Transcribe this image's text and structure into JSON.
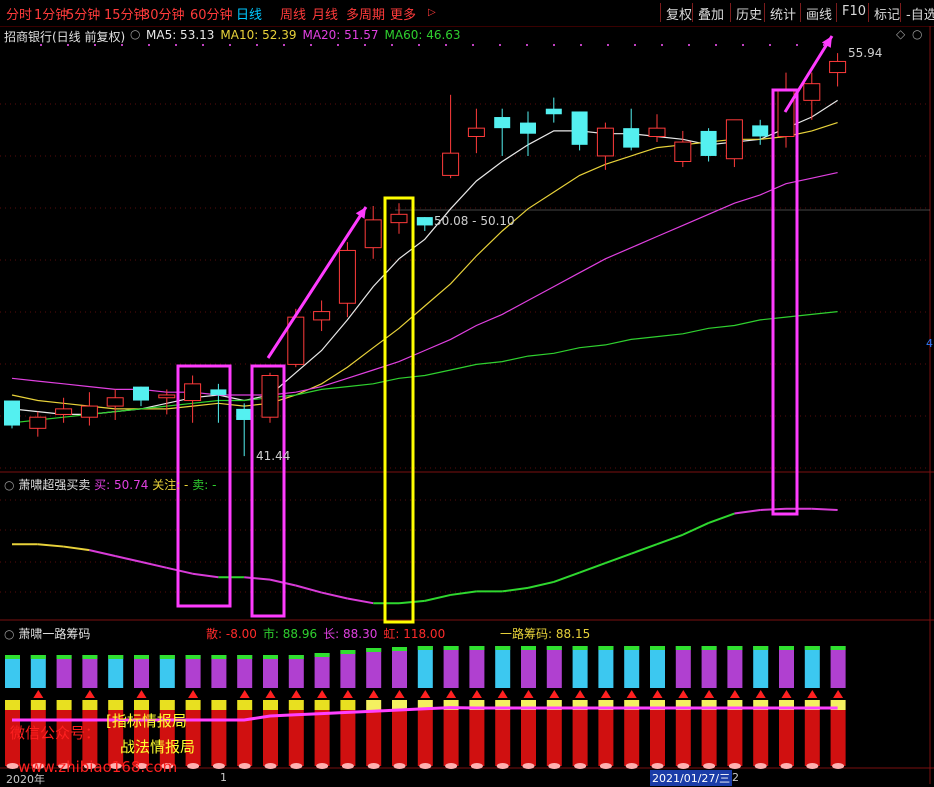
{
  "toolbar": {
    "periods": [
      "分时",
      "1分钟",
      "5分钟",
      "15分钟",
      "30分钟",
      "60分钟",
      "日线",
      "周线",
      "月线",
      "多周期",
      "更多"
    ],
    "active_period": "日线",
    "more_arrow": "▷",
    "right_buttons": [
      "复权",
      "叠加",
      "历史",
      "统计",
      "画线",
      "F10",
      "标记",
      "-自选"
    ]
  },
  "main_pane": {
    "title": "招商银行(日线 前复权)",
    "ma_items": [
      {
        "label": "MA5: 53.13",
        "color": "#e8e8e8"
      },
      {
        "label": "MA10: 52.39",
        "color": "#e8d23a"
      },
      {
        "label": "MA20: 51.57",
        "color": "#e040e0"
      },
      {
        "label": "MA60: 46.63",
        "color": "#2fd02f"
      }
    ],
    "high_label": "55.94",
    "low_label": "41.44",
    "range_label": "50.08 - 50.10",
    "axis_marker": "4",
    "diamond_icon": "◇",
    "close_icon": "○"
  },
  "indicator1": {
    "title": "萧啸超强买卖",
    "buy_label": "买: 50.74",
    "follow_label": "关注: -",
    "sell_label": "卖: -"
  },
  "indicator2": {
    "title": "萧啸一路筹码",
    "items": [
      {
        "label": "散: -8.00",
        "color": "#ff2b2b"
      },
      {
        "label": "市: 88.96",
        "color": "#2fd02f"
      },
      {
        "label": "长: 88.30",
        "color": "#e040e0"
      },
      {
        "label": "虹: 118.00",
        "color": "#ff2b2b"
      }
    ],
    "chip_label": "一路筹码: 88.15"
  },
  "bottom_axis": {
    "year_label": "2020年",
    "tick_label": "1",
    "date_label": "2021/01/27/三",
    "date_suffix": "2"
  },
  "watermark": {
    "line1": "微信公众号：",
    "line1b": "[指标情报局",
    "line2": "战法情报局",
    "line3": "www.zhibiao168.com"
  },
  "colors": {
    "up": "#ff3b3b",
    "down": "#54f0f0",
    "ma5": "#e8e8e8",
    "ma10": "#e8d23a",
    "ma20": "#e040e0",
    "ma60": "#2fd02f",
    "box_magenta": "#ff3cff",
    "box_yellow": "#ffff00"
  },
  "chart_data": {
    "type": "candlestick",
    "title": "招商银行(日线 前复权)",
    "candles": [
      {
        "o": 43.4,
        "h": 43.4,
        "l": 42.4,
        "c": 42.5
      },
      {
        "o": 42.4,
        "h": 43.0,
        "l": 42.1,
        "c": 42.8
      },
      {
        "o": 42.9,
        "h": 43.5,
        "l": 42.6,
        "c": 43.1
      },
      {
        "o": 42.8,
        "h": 43.7,
        "l": 42.5,
        "c": 43.2
      },
      {
        "o": 43.2,
        "h": 43.8,
        "l": 42.7,
        "c": 43.5
      },
      {
        "o": 43.9,
        "h": 43.9,
        "l": 43.2,
        "c": 43.4
      },
      {
        "o": 43.5,
        "h": 43.8,
        "l": 42.9,
        "c": 43.6
      },
      {
        "o": 43.4,
        "h": 44.3,
        "l": 42.6,
        "c": 44.0
      },
      {
        "o": 43.8,
        "h": 44.0,
        "l": 42.6,
        "c": 43.6
      },
      {
        "o": 43.1,
        "h": 43.3,
        "l": 41.4,
        "c": 42.7
      },
      {
        "o": 42.8,
        "h": 44.4,
        "l": 42.6,
        "c": 44.3
      },
      {
        "o": 44.7,
        "h": 46.7,
        "l": 44.6,
        "c": 46.4
      },
      {
        "o": 46.3,
        "h": 47.0,
        "l": 45.9,
        "c": 46.6
      },
      {
        "o": 46.9,
        "h": 49.1,
        "l": 46.4,
        "c": 48.8
      },
      {
        "o": 48.9,
        "h": 50.4,
        "l": 48.5,
        "c": 49.9
      },
      {
        "o": 49.8,
        "h": 50.5,
        "l": 49.4,
        "c": 50.1
      },
      {
        "o": 50.0,
        "h": 50.0,
        "l": 49.5,
        "c": 49.7
      },
      {
        "o": 51.5,
        "h": 54.4,
        "l": 51.4,
        "c": 52.3
      },
      {
        "o": 52.9,
        "h": 53.9,
        "l": 52.3,
        "c": 53.2
      },
      {
        "o": 53.6,
        "h": 53.9,
        "l": 52.2,
        "c": 53.2
      },
      {
        "o": 53.4,
        "h": 53.8,
        "l": 52.2,
        "c": 53.0
      },
      {
        "o": 53.9,
        "h": 54.3,
        "l": 53.4,
        "c": 53.7
      },
      {
        "o": 53.8,
        "h": 53.8,
        "l": 52.4,
        "c": 52.6
      },
      {
        "o": 52.2,
        "h": 53.4,
        "l": 51.7,
        "c": 53.2
      },
      {
        "o": 53.2,
        "h": 53.9,
        "l": 52.4,
        "c": 52.5
      },
      {
        "o": 52.9,
        "h": 53.7,
        "l": 52.7,
        "c": 53.2
      },
      {
        "o": 52.0,
        "h": 53.1,
        "l": 51.8,
        "c": 52.7
      },
      {
        "o": 53.1,
        "h": 53.2,
        "l": 52.0,
        "c": 52.2
      },
      {
        "o": 52.1,
        "h": 53.5,
        "l": 51.8,
        "c": 53.5
      },
      {
        "o": 53.3,
        "h": 53.5,
        "l": 52.6,
        "c": 52.9
      },
      {
        "o": 52.9,
        "h": 55.2,
        "l": 52.5,
        "c": 54.6
      },
      {
        "o": 54.2,
        "h": 55.2,
        "l": 53.5,
        "c": 54.8
      },
      {
        "o": 55.2,
        "h": 55.9,
        "l": 54.7,
        "c": 55.6
      }
    ],
    "series": [
      {
        "name": "MA5",
        "values": [
          43.1,
          43.0,
          42.9,
          42.9,
          43.0,
          43.1,
          43.3,
          43.5,
          43.6,
          43.4,
          43.6,
          44.4,
          45.2,
          46.3,
          47.5,
          48.5,
          49.2,
          50.3,
          51.3,
          52.0,
          52.6,
          53.1,
          53.1,
          53.0,
          53.0,
          52.9,
          52.8,
          52.6,
          52.7,
          52.8,
          53.2,
          53.6,
          54.2
        ]
      },
      {
        "name": "MA10",
        "values": [
          43.6,
          43.4,
          43.3,
          43.2,
          43.1,
          43.1,
          43.1,
          43.2,
          43.3,
          43.2,
          43.3,
          43.6,
          44.0,
          44.6,
          45.3,
          46.0,
          46.8,
          47.6,
          48.6,
          49.5,
          50.3,
          50.9,
          51.5,
          51.9,
          52.2,
          52.5,
          52.6,
          52.7,
          52.8,
          52.8,
          52.9,
          53.1,
          53.4
        ]
      },
      {
        "name": "MA20",
        "values": [
          44.2,
          44.1,
          44.0,
          43.9,
          43.8,
          43.8,
          43.7,
          43.7,
          43.6,
          43.6,
          43.6,
          43.7,
          43.9,
          44.2,
          44.5,
          44.8,
          45.2,
          45.6,
          46.1,
          46.5,
          47.0,
          47.5,
          48.0,
          48.5,
          48.9,
          49.3,
          49.7,
          50.1,
          50.5,
          50.8,
          51.2,
          51.4,
          51.6
        ]
      },
      {
        "name": "MA60",
        "values": [
          42.6,
          42.7,
          42.8,
          42.9,
          43.0,
          43.1,
          43.2,
          43.3,
          43.4,
          43.4,
          43.5,
          43.6,
          43.8,
          43.9,
          44.0,
          44.2,
          44.3,
          44.5,
          44.7,
          44.8,
          45.0,
          45.1,
          45.3,
          45.4,
          45.6,
          45.7,
          45.8,
          46.0,
          46.1,
          46.3,
          46.4,
          46.5,
          46.6
        ]
      }
    ],
    "indicator_line": {
      "name": "萧啸超强买卖",
      "values": [
        60,
        60,
        58,
        55,
        50,
        45,
        40,
        35,
        32,
        32,
        30,
        25,
        19,
        14,
        10,
        10,
        12,
        17,
        20,
        20,
        23,
        28,
        36,
        44,
        52,
        60,
        68,
        78,
        86,
        89,
        90,
        90,
        89
      ],
      "colors": [
        "yellow",
        "yellow",
        "yellow",
        "yellow",
        "magenta",
        "magenta",
        "magenta",
        "magenta",
        "magenta",
        "green",
        "magenta",
        "magenta",
        "magenta",
        "magenta",
        "magenta",
        "green",
        "green",
        "green",
        "green",
        "green",
        "green",
        "green",
        "green",
        "green",
        "green",
        "green",
        "green",
        "green",
        "green",
        "magenta",
        "magenta",
        "magenta",
        "magenta"
      ]
    },
    "chip_bars": {
      "types": [
        "cyan",
        "cyan",
        "magenta",
        "magenta",
        "cyan",
        "magenta",
        "cyan",
        "magenta",
        "magenta",
        "magenta",
        "magenta",
        "magenta",
        "magenta",
        "magenta",
        "magenta",
        "magenta",
        "cyan",
        "magenta",
        "magenta",
        "cyan",
        "magenta",
        "magenta",
        "cyan",
        "cyan",
        "cyan",
        "cyan",
        "magenta",
        "magenta",
        "magenta",
        "cyan",
        "magenta",
        "cyan",
        "magenta"
      ],
      "heights": [
        33,
        33,
        33,
        33,
        33,
        33,
        33,
        33,
        33,
        33,
        33,
        33,
        35,
        38,
        40,
        41,
        42,
        42,
        42,
        42,
        42,
        42,
        42,
        42,
        42,
        42,
        42,
        42,
        42,
        42,
        42,
        42,
        42
      ]
    }
  }
}
